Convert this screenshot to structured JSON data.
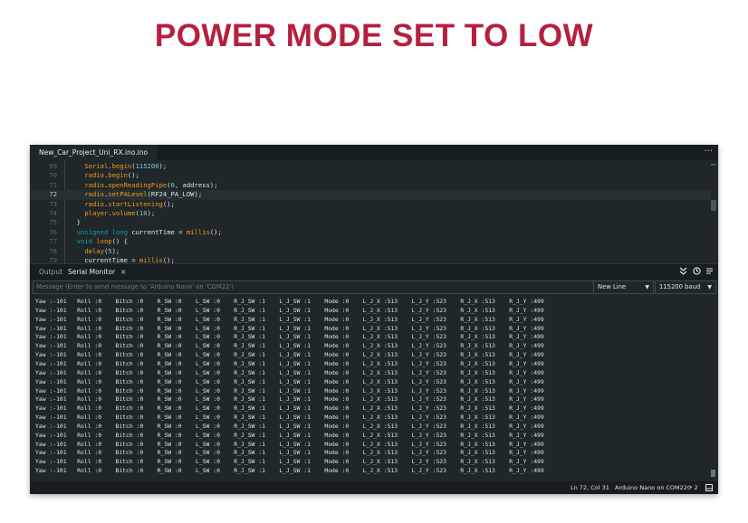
{
  "slide": {
    "title": "POWER MODE SET TO LOW"
  },
  "ide": {
    "file_tab": "New_Car_Project_Uni_RX.ino.ino",
    "more_glyph": "···",
    "active_line": 72,
    "code": [
      {
        "n": "69",
        "segs": [
          [
            "    ",
            ""
          ],
          [
            "Serial",
            "fn"
          ],
          [
            ".",
            ""
          ],
          [
            "begin",
            "fn"
          ],
          [
            "(",
            ""
          ],
          [
            "115200",
            "num"
          ],
          [
            ");",
            ""
          ]
        ]
      },
      {
        "n": "70",
        "segs": [
          [
            "    ",
            ""
          ],
          [
            "radio",
            "fn"
          ],
          [
            ".",
            ""
          ],
          [
            "begin",
            "fn"
          ],
          [
            "();",
            ""
          ]
        ]
      },
      {
        "n": "71",
        "segs": [
          [
            "    ",
            ""
          ],
          [
            "radio",
            "fn"
          ],
          [
            ".",
            ""
          ],
          [
            "openReadingPipe",
            "fn"
          ],
          [
            "(",
            ""
          ],
          [
            "0",
            "num"
          ],
          [
            ", address);",
            ""
          ]
        ]
      },
      {
        "n": "72",
        "segs": [
          [
            "    ",
            ""
          ],
          [
            "radio",
            "fn"
          ],
          [
            ".",
            ""
          ],
          [
            "setPALevel",
            "fn"
          ],
          [
            "(RF24_PA_LOW);",
            ""
          ]
        ]
      },
      {
        "n": "73",
        "segs": [
          [
            "    ",
            ""
          ],
          [
            "radio",
            "fn"
          ],
          [
            ".",
            ""
          ],
          [
            "startListening",
            "fn"
          ],
          [
            "();",
            ""
          ]
        ]
      },
      {
        "n": "74",
        "segs": [
          [
            "    ",
            ""
          ],
          [
            "player",
            "fn"
          ],
          [
            ".",
            ""
          ],
          [
            "volume",
            "fn"
          ],
          [
            "(",
            ""
          ],
          [
            "10",
            "num"
          ],
          [
            ");",
            ""
          ]
        ]
      },
      {
        "n": "75",
        "segs": [
          [
            "  }",
            ""
          ]
        ]
      },
      {
        "n": "76",
        "segs": [
          [
            "  ",
            ""
          ],
          [
            "unsigned long",
            "kw"
          ],
          [
            " currentTime = ",
            ""
          ],
          [
            "millis",
            "fn"
          ],
          [
            "();",
            ""
          ]
        ]
      },
      {
        "n": "77",
        "segs": [
          [
            "  ",
            ""
          ],
          [
            "void",
            "kw"
          ],
          [
            " ",
            ""
          ],
          [
            "loop",
            "fn"
          ],
          [
            "() {",
            ""
          ]
        ]
      },
      {
        "n": "78",
        "segs": [
          [
            "    ",
            ""
          ],
          [
            "delay",
            "fn"
          ],
          [
            "(",
            ""
          ],
          [
            "5",
            "num"
          ],
          [
            ");",
            ""
          ]
        ]
      },
      {
        "n": "79",
        "segs": [
          [
            "    currentTime = ",
            ""
          ],
          [
            "millis",
            "fn"
          ],
          [
            "();",
            ""
          ]
        ]
      }
    ],
    "panel": {
      "tab_output": "Output",
      "tab_serial": "Serial Monitor",
      "close_glyph": "×"
    },
    "message_placeholder": "Message (Enter to send message to 'Arduino Nano' on 'COM22')",
    "line_ending": "New Line",
    "baud": "115200 baud",
    "serial_line": "Yaw :-101   Roll :0    Bitch :0    R_SW :0    L_SW :0    R_J_SW :1    L_J_SW :1    Mode :0    L_J_X :513    L_J_Y :523    R_J_X :513    R_J_Y :499",
    "serial_line_count": 20,
    "status": {
      "position": "Ln 72, Col 31",
      "board": "Arduino Nano on COM22",
      "notif": "2"
    }
  }
}
